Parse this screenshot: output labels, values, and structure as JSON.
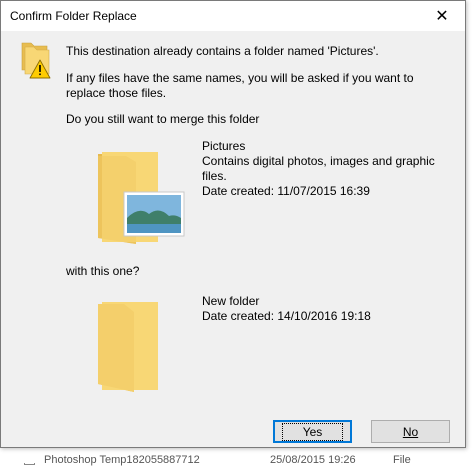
{
  "dialog": {
    "title": "Confirm Folder Replace",
    "close_glyph": "✕",
    "message_line1": "This destination already contains a folder named 'Pictures'.",
    "message_line2": "If any files have the same names, you will be asked if you want to replace those files.",
    "message_line3": "Do you still want to merge this folder",
    "source_folder": {
      "name": "Pictures",
      "description": "Contains digital photos, images and graphic files.",
      "date_created": "Date created: 11/07/2015 16:39"
    },
    "with_this_one": "with this one?",
    "destination_folder": {
      "name": "New folder",
      "date_created": "Date created: 14/10/2016 19:18"
    },
    "buttons": {
      "yes_label": "Yes",
      "no_label": "No"
    }
  },
  "background": {
    "row_name": "Photoshop Temp182055887712",
    "row_date": "25/08/2015 19:26",
    "row_type": "File"
  },
  "colors": {
    "dialog_bg": "#f0f0f0",
    "titlebar_bg": "#ffffff",
    "default_button_border": "#0078d7",
    "folder_yellow": "#f8d775",
    "warning_yellow": "#ffcc00"
  },
  "icons": {
    "warning": "folder-warning-icon",
    "source_folder": "pictures-folder-icon",
    "destination_folder": "folder-icon",
    "close": "close-icon"
  }
}
